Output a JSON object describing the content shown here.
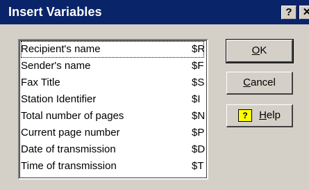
{
  "window": {
    "title": "Insert Variables",
    "help_glyph": "?",
    "close_glyph": "✕"
  },
  "variables": [
    {
      "name": "Recipient's name",
      "code": "$R"
    },
    {
      "name": "Sender's name",
      "code": "$F"
    },
    {
      "name": "Fax Title",
      "code": "$S"
    },
    {
      "name": "Station Identifier",
      "code": "$I"
    },
    {
      "name": "Total number of pages",
      "code": "$N"
    },
    {
      "name": "Current page number",
      "code": "$P"
    },
    {
      "name": "Date of transmission",
      "code": "$D"
    },
    {
      "name": "Time of transmission",
      "code": "$T"
    }
  ],
  "buttons": {
    "ok": "OK",
    "cancel": "Cancel",
    "help": "Help",
    "help_icon": "question-book-icon"
  },
  "colors": {
    "titlebar": "#0a246a",
    "dialog_bg": "#d4d0c8",
    "help_icon_bg": "#ffff00"
  }
}
